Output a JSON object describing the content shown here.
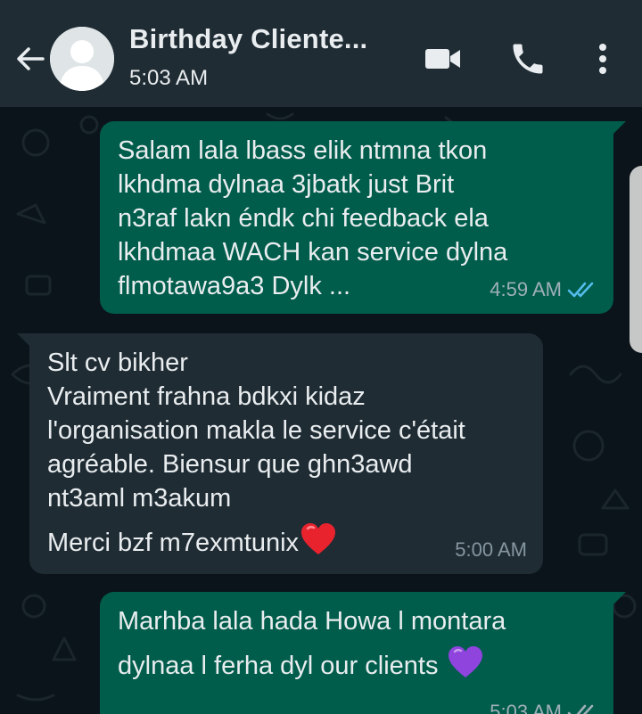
{
  "header": {
    "contact_name": "Birthday Cliente...",
    "last_seen": "5:03 AM"
  },
  "icons": {
    "back": "arrow-left-icon",
    "avatar": "default-avatar-icon",
    "video": "video-call-icon",
    "call": "phone-icon",
    "menu": "more-vertical-icon",
    "read": "double-check-icon",
    "heart": "red-heart-emoji",
    "purple_heart": "purple-heart-emoji"
  },
  "colors": {
    "header_bg": "#1f2c34",
    "chat_bg": "#0b141a",
    "outgoing_bubble": "#005c4b",
    "incoming_bubble": "#1f2c34",
    "read_check": "#53bdeb"
  },
  "messages": [
    {
      "direction": "outgoing",
      "lines": [
        "Salam lala lbass elik ntmna tkon",
        "lkhdma dylnaa 3jbatk  just Brit",
        "n3raf lakn éndk chi feedback ela",
        "lkhdmaa WACH kan service dylna",
        "flmotawa9a3 Dylk ..."
      ],
      "time": "4:59 AM",
      "status": "read"
    },
    {
      "direction": "incoming",
      "lines": [
        "Slt cv bikher",
        "Vraiment frahna bdkxi kidaz",
        "l'organisation makla le service c'était",
        "agréable. Biensur que ghn3awd",
        "nt3aml m3akum",
        "Merci bzf m7exmtunix"
      ],
      "time": "5:00 AM"
    },
    {
      "direction": "outgoing",
      "lines": [
        "Marhba lala hada Howa l montara",
        "dylnaa l ferha dyl our clients"
      ],
      "time": "5:03 AM",
      "status": "delivered"
    }
  ]
}
